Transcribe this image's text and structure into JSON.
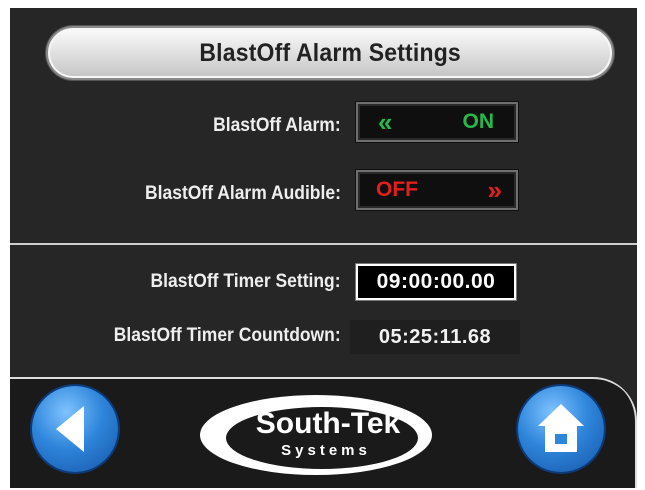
{
  "title": "BlastOff Alarm Settings",
  "alarm": {
    "label": "BlastOff Alarm:",
    "state": "ON",
    "chevron": "«"
  },
  "audible": {
    "label": "BlastOff Alarm Audible:",
    "state": "OFF",
    "chevron": "»"
  },
  "timer_setting": {
    "label": "BlastOff Timer Setting:",
    "value": "09:00:00.00"
  },
  "timer_countdown": {
    "label": "BlastOff Timer Countdown:",
    "value": "05:25:11.68"
  },
  "logo": {
    "line1": "South-Tek",
    "line2": "Systems"
  },
  "icons": {
    "back": "back-arrow-icon",
    "home": "home-icon"
  },
  "colors": {
    "on": "#27b84a",
    "off": "#e21f1f",
    "button_blue": "#2f86db"
  }
}
